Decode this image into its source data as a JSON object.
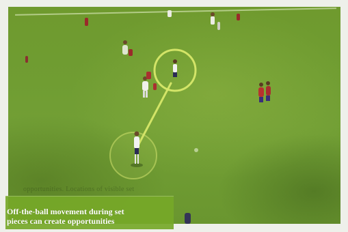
{
  "caption": {
    "text": "Off-the-ball movement during set\npieces can create opportunities",
    "partial_text": "opportunities. Locations of visible set"
  },
  "scene": {
    "highlight_color": "#d8e86a",
    "home_kit_color": "#f2f2f2",
    "away_kit_color": "#b8322e",
    "away_shorts_color": "#3a2f7a"
  },
  "icons": [
    "highlight-ring-icon",
    "pass-line-icon",
    "player-icon"
  ]
}
